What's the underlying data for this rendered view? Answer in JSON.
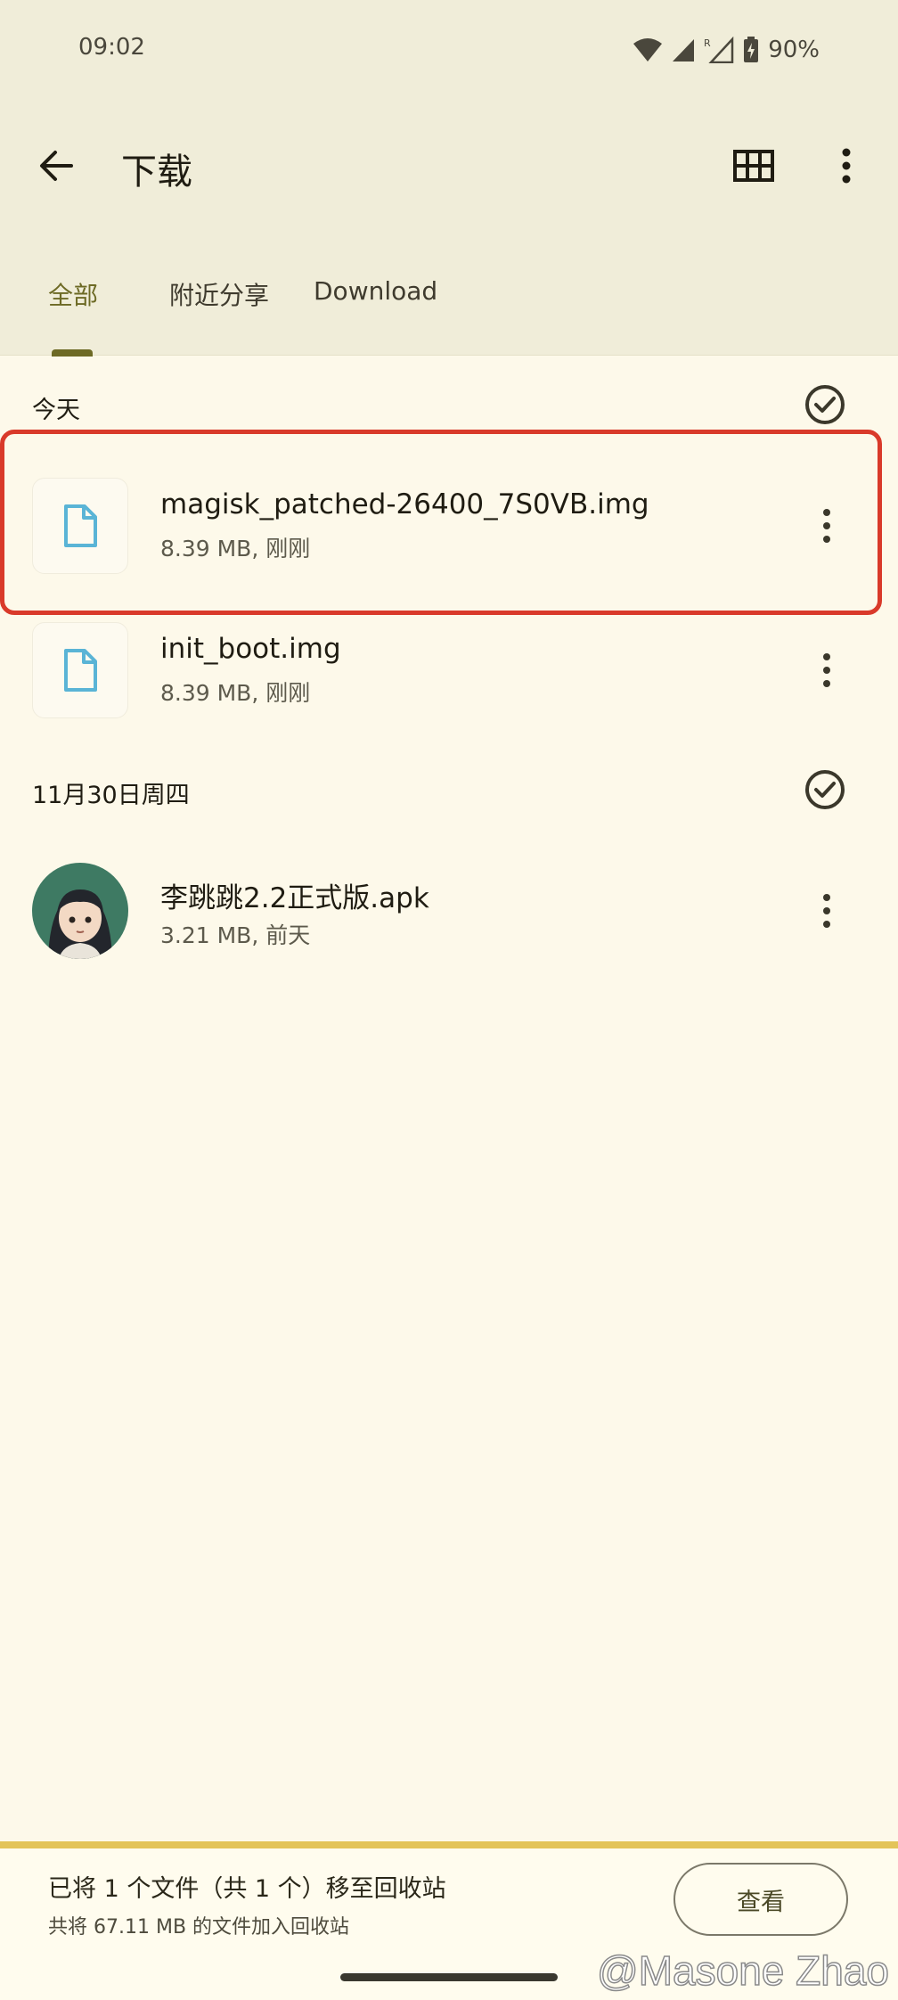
{
  "status_bar": {
    "time": "09:02",
    "battery": "90%"
  },
  "app_bar": {
    "title": "下载"
  },
  "tabs": [
    {
      "label": "全部",
      "selected": true
    },
    {
      "label": "附近分享",
      "selected": false
    },
    {
      "label": "Download",
      "selected": false
    }
  ],
  "sections": [
    {
      "header": "今天",
      "files": [
        {
          "name": "magisk_patched-26400_7S0VB.img",
          "meta": "8.39 MB, 刚刚",
          "icon": "document-icon",
          "highlighted": true
        },
        {
          "name": "init_boot.img",
          "meta": "8.39 MB, 刚刚",
          "icon": "document-icon",
          "highlighted": false
        }
      ]
    },
    {
      "header": "11月30日周四",
      "files": [
        {
          "name": "李跳跳2.2正式版.apk",
          "meta": "3.21 MB, 前天",
          "icon": "app-avatar",
          "highlighted": false
        }
      ]
    }
  ],
  "snackbar": {
    "message": "已将 1 个文件（共 1 个）移至回收站",
    "sub_message": "共将 67.11 MB 的文件加入回收站",
    "action_label": "查看"
  },
  "watermark": "@Masone Zhao",
  "colors": {
    "accent": "#6d6a25",
    "highlight_border": "#d93a2a",
    "file_icon": "#5ab4d6",
    "snackbar_line": "#e3c45a"
  }
}
